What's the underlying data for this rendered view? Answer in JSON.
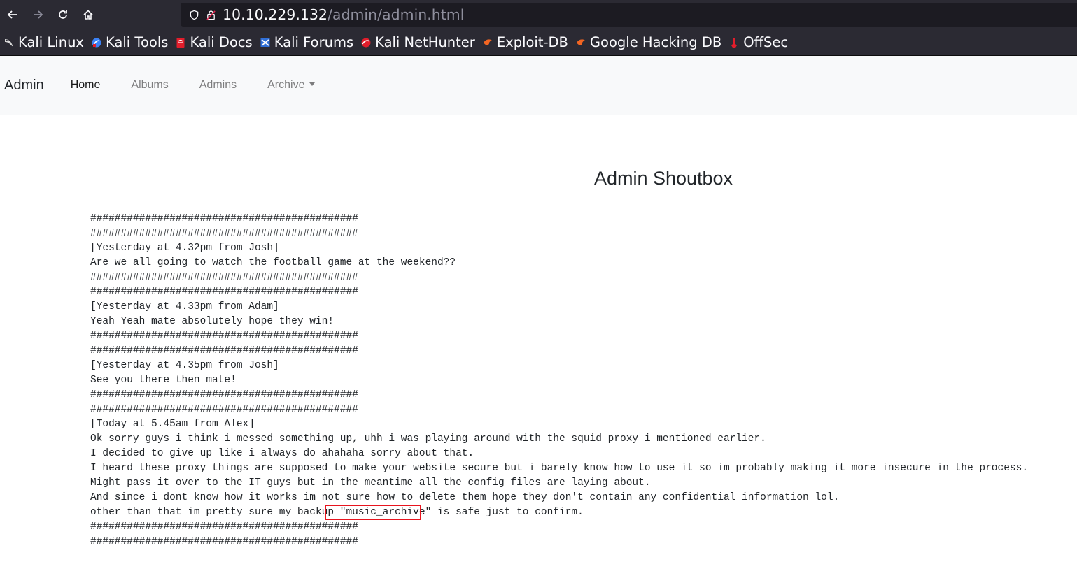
{
  "browser": {
    "url_host": "10.10.229.132",
    "url_path": "/admin/admin.html",
    "bookmarks": [
      {
        "label": "Kali Linux",
        "icon": "kali-dragon-icon",
        "color": "#ffffff"
      },
      {
        "label": "Kali Tools",
        "icon": "kali-tools-icon",
        "color": "#3b82f6"
      },
      {
        "label": "Kali Docs",
        "icon": "kali-docs-icon",
        "color": "#e11d2b"
      },
      {
        "label": "Kali Forums",
        "icon": "kali-forums-icon",
        "color": "#2f6fd8"
      },
      {
        "label": "Kali NetHunter",
        "icon": "kali-nethunter-icon",
        "color": "#e11d2b"
      },
      {
        "label": "Exploit-DB",
        "icon": "exploit-db-icon",
        "color": "#f26522"
      },
      {
        "label": "Google Hacking DB",
        "icon": "ghdb-icon",
        "color": "#f26522"
      },
      {
        "label": "OffSec",
        "icon": "offsec-icon",
        "color": "#e11d2b"
      }
    ]
  },
  "navbar": {
    "brand": "Admin",
    "links": [
      {
        "label": "Home",
        "active": true
      },
      {
        "label": "Albums",
        "active": false
      },
      {
        "label": "Admins",
        "active": false
      },
      {
        "label": "Archive",
        "active": false,
        "dropdown": true
      }
    ]
  },
  "main": {
    "heading": "Admin Shoutbox",
    "lines": [
      "############################################",
      "############################################",
      "[Yesterday at 4.32pm from Josh]",
      "Are we all going to watch the football game at the weekend??",
      "############################################",
      "############################################",
      "[Yesterday at 4.33pm from Adam]",
      "Yeah Yeah mate absolutely hope they win!",
      "############################################",
      "############################################",
      "[Yesterday at 4.35pm from Josh]",
      "See you there then mate!",
      "############################################",
      "############################################",
      "[Today at 5.45am from Alex]",
      "Ok sorry guys i think i messed something up, uhh i was playing around with the squid proxy i mentioned earlier.",
      "I decided to give up like i always do ahahaha sorry about that.",
      "I heard these proxy things are supposed to make your website secure but i barely know how to use it so im probably making it more insecure in the process.",
      "Might pass it over to the IT guys but in the meantime all the config files are laying about.",
      "And since i dont know how it works im not sure how to delete them hope they don't contain any confidential information lol.",
      "other than that im pretty sure my backup \"music_archive\" is safe just to confirm.",
      "############################################",
      "############################################"
    ]
  },
  "annotation": {
    "color": "#e8141e"
  }
}
